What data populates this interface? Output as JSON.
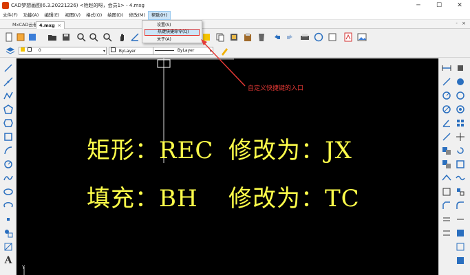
{
  "window": {
    "title": "CAD梦想画图(6.3.20221226) <姓赵的呀，会员1> - 4.mxg",
    "controls": [
      "minimize",
      "maximize",
      "close"
    ]
  },
  "menu": {
    "items": [
      "文件(F)",
      "功能(A)",
      "编辑(E)",
      "视图(V)",
      "格式(O)",
      "绘图(D)",
      "修改(M)",
      "帮助(H)"
    ]
  },
  "tabs": {
    "cloud": "MxCAD云参",
    "doc": "4.mxg",
    "doc_close": "×",
    "controls": "-  ×"
  },
  "layers": {
    "layer_value": "0",
    "color_value": "ByLayer",
    "linetype_value": "ByLayer"
  },
  "help_dropdown": {
    "items": [
      "设置(S)",
      "热键快捷命令(Q)",
      "关于(A)"
    ],
    "highlighted_index": 1
  },
  "canvas": {
    "line1_left": "矩形：REC",
    "line1_right": "修改为：JX",
    "line2_left": "填充：BH",
    "line2_right": "修改为：TC",
    "text_color": "#ffff4a"
  },
  "annotation": {
    "text": "自定义快捷键的入口",
    "color": "#e53935"
  },
  "axis_label": "Y"
}
